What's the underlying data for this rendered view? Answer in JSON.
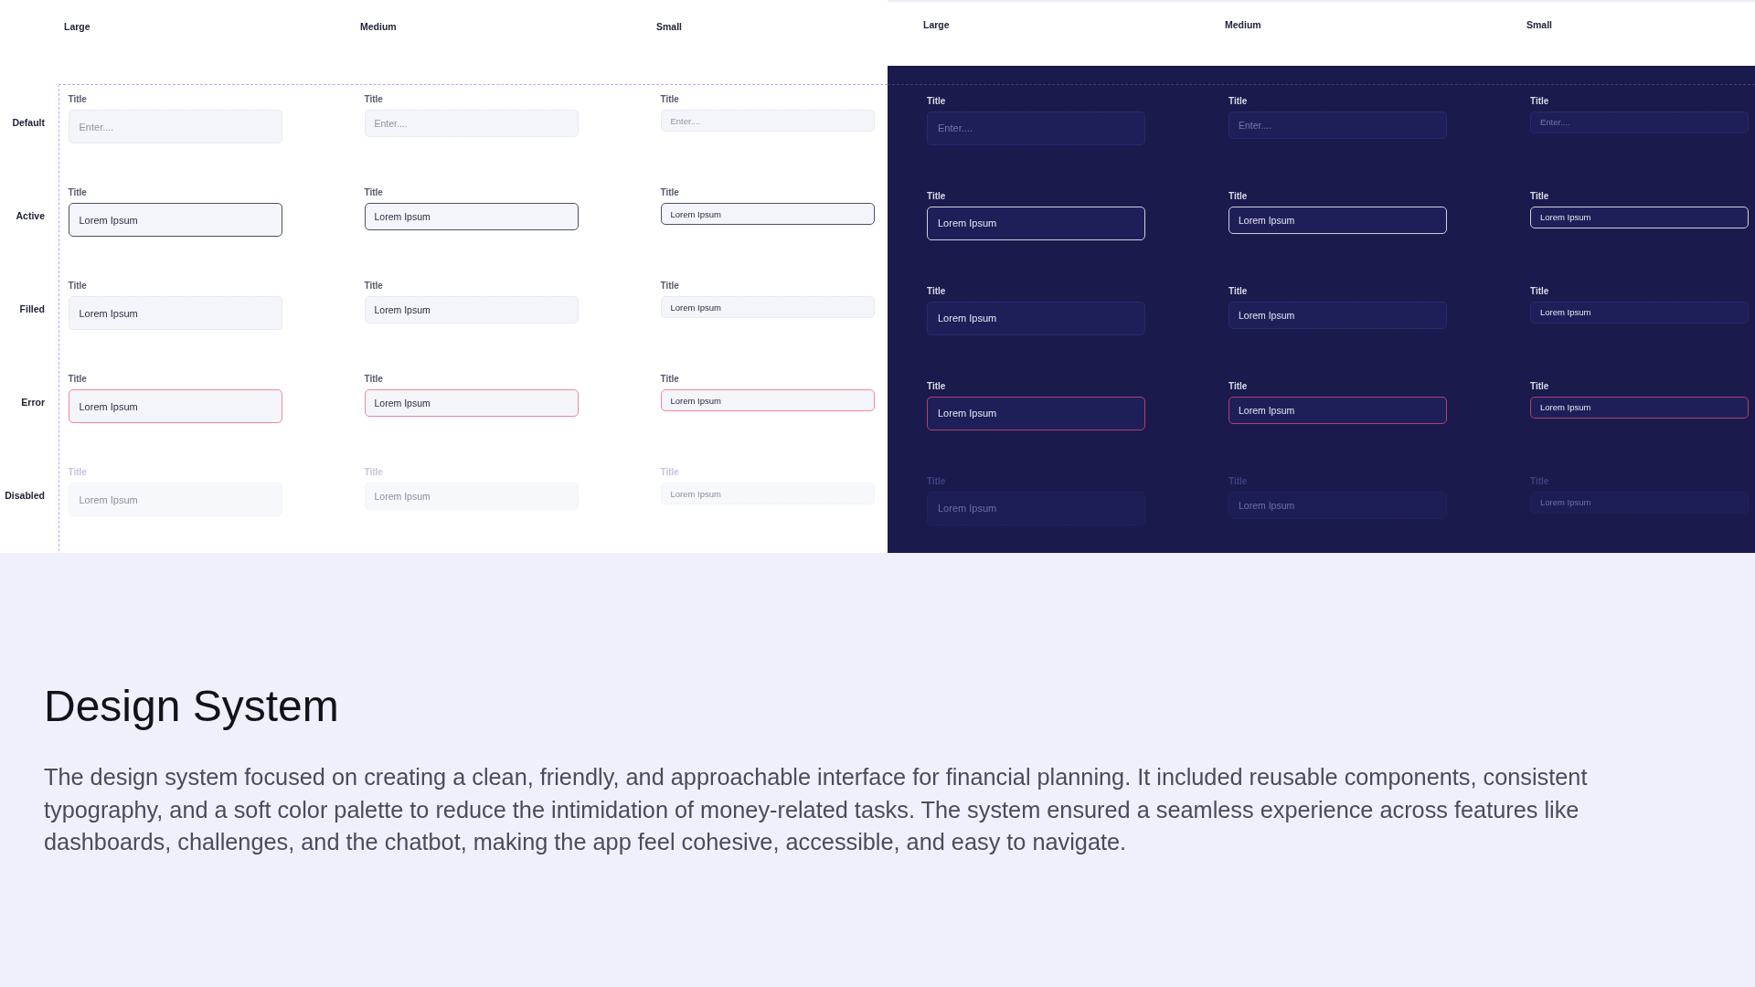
{
  "light_panel": {
    "column_headers": [
      "Large",
      "Medium",
      "Small"
    ],
    "rows": [
      {
        "label": "Default",
        "fields": [
          {
            "title": "Title",
            "placeholder": "Enter....",
            "active": false,
            "error": false,
            "disabled": false
          },
          {
            "title": "Title",
            "placeholder": "Enter....",
            "active": false,
            "error": false,
            "disabled": false
          },
          {
            "title": "Title",
            "placeholder": "Enter....",
            "active": false,
            "error": false,
            "disabled": false
          }
        ]
      },
      {
        "label": "Active",
        "fields": [
          {
            "title": "Title",
            "value": "Lorem Ipsum",
            "active": true,
            "error": false,
            "disabled": false
          },
          {
            "title": "Title",
            "value": "Lorem Ipsum",
            "active": true,
            "error": false,
            "disabled": false
          },
          {
            "title": "Title",
            "value": "Lorem Ipsum",
            "active": true,
            "error": false,
            "disabled": false
          }
        ]
      },
      {
        "label": "Filled",
        "fields": [
          {
            "title": "Title",
            "value": "Lorem Ipsum",
            "active": false,
            "error": false,
            "disabled": false
          },
          {
            "title": "Title",
            "value": "Lorem Ipsum",
            "active": false,
            "error": false,
            "disabled": false
          },
          {
            "title": "Title",
            "value": "Lorem Ipsum",
            "active": false,
            "error": false,
            "disabled": false
          }
        ]
      },
      {
        "label": "Error",
        "fields": [
          {
            "title": "Title",
            "value": "Lorem Ipsum",
            "active": false,
            "error": true,
            "disabled": false
          },
          {
            "title": "Title",
            "value": "Lorem Ipsum",
            "active": false,
            "error": true,
            "disabled": false
          },
          {
            "title": "Title",
            "value": "Lorem Ipsum",
            "active": false,
            "error": true,
            "disabled": false
          }
        ]
      },
      {
        "label": "Disabled",
        "fields": [
          {
            "title": "Title",
            "value": "Lorem Ipsum",
            "active": false,
            "error": false,
            "disabled": true
          },
          {
            "title": "Title",
            "value": "Lorem Ipsum",
            "active": false,
            "error": false,
            "disabled": true
          },
          {
            "title": "Title",
            "value": "Lorem Ipsum",
            "active": false,
            "error": false,
            "disabled": true
          }
        ]
      }
    ]
  },
  "dark_panel": {
    "column_headers": [
      "Large",
      "Medium",
      "Small"
    ],
    "rows": [
      {
        "fields": [
          {
            "title": "Title",
            "placeholder": "Enter....",
            "active": false,
            "error": false,
            "disabled": false
          },
          {
            "title": "Title",
            "placeholder": "Enter....",
            "active": false,
            "error": false,
            "disabled": false
          },
          {
            "title": "Title",
            "placeholder": "Enter....",
            "active": false,
            "error": false,
            "disabled": false
          }
        ]
      },
      {
        "fields": [
          {
            "title": "Title",
            "value": "Lorem Ipsum",
            "active": true,
            "error": false,
            "disabled": false
          },
          {
            "title": "Title",
            "value": "Lorem Ipsum",
            "active": true,
            "error": false,
            "disabled": false
          },
          {
            "title": "Title",
            "value": "Lorem Ipsum",
            "active": true,
            "error": false,
            "disabled": false
          }
        ]
      },
      {
        "fields": [
          {
            "title": "Title",
            "value": "Lorem Ipsum",
            "active": false,
            "error": false,
            "disabled": false
          },
          {
            "title": "Title",
            "value": "Lorem Ipsum",
            "active": false,
            "error": false,
            "disabled": false
          },
          {
            "title": "Title",
            "value": "Lorem Ipsum",
            "active": false,
            "error": false,
            "disabled": false
          }
        ]
      },
      {
        "fields": [
          {
            "title": "Title",
            "value": "Lorem Ipsum",
            "active": false,
            "error": true,
            "disabled": false
          },
          {
            "title": "Title",
            "value": "Lorem Ipsum",
            "active": false,
            "error": true,
            "disabled": false
          },
          {
            "title": "Title",
            "value": "Lorem Ipsum",
            "active": false,
            "error": true,
            "disabled": false
          }
        ]
      },
      {
        "fields": [
          {
            "title": "Title",
            "value": "Lorem Ipsum",
            "active": false,
            "error": false,
            "disabled": true
          },
          {
            "title": "Title",
            "value": "Lorem Ipsum",
            "active": false,
            "error": false,
            "disabled": true
          },
          {
            "title": "Title",
            "value": "Lorem Ipsum",
            "active": false,
            "error": false,
            "disabled": true
          }
        ]
      }
    ]
  },
  "section": {
    "heading": "Design System",
    "body": "The design system focused on creating a clean, friendly, and approachable interface for financial planning. It included reusable components, consistent typography, and a soft color palette to reduce the intimidation of money-related tasks. The system ensured a seamless experience across features like dashboards, challenges, and the chatbot, making the app feel cohesive, accessible, and easy to navigate."
  }
}
